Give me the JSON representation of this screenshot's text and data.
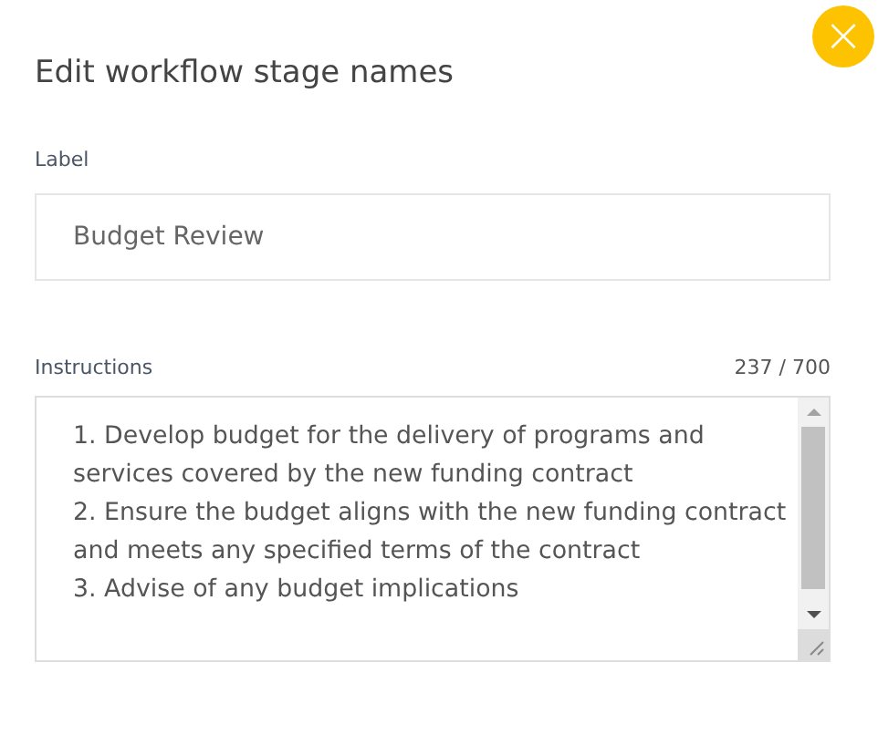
{
  "dialog": {
    "title": "Edit workflow stage names",
    "close_button": {
      "icon": "×"
    }
  },
  "label_field": {
    "label": "Label",
    "value": "Budget Review"
  },
  "instructions_field": {
    "label": "Instructions",
    "counter": "237 / 700",
    "value": "1. Develop budget for the delivery of programs and services covered by the new funding contract\n2. Ensure the budget aligns with the new funding contract and meets any specified terms of the contract\n3. Advise of any budget implications"
  }
}
